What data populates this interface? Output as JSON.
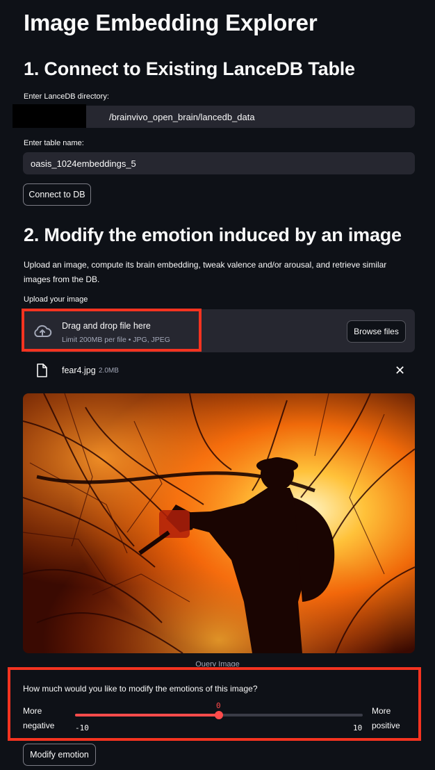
{
  "app_title": "Image Embedding Explorer",
  "section1": {
    "heading": "1. Connect to Existing LanceDB Table",
    "dir_label": "Enter LanceDB directory:",
    "dir_value": "/brainvivo_open_brain/lancedb_data",
    "table_label": "Enter table name:",
    "table_value": "oasis_1024embeddings_5",
    "connect_button": "Connect to DB"
  },
  "section2": {
    "heading": "2. Modify the emotion induced by an image",
    "description": "Upload an image, compute its brain embedding, tweak valence and/or arousal, and retrieve similar images from the DB.",
    "upload_label": "Upload your image",
    "dropzone_title": "Drag and drop file here",
    "dropzone_limit": "Limit 200MB per file • JPG, JPEG",
    "browse_button": "Browse files",
    "file_name": "fear4.jpg",
    "file_size": "2.0MB",
    "close_icon": "close-icon",
    "image_caption": "Query Image",
    "question": "How much would you like to modify the emotions of this image?",
    "left_label_1": "More",
    "left_label_2": "negative",
    "right_label_1": "More",
    "right_label_2": "positive",
    "slider_value": "0",
    "slider_min": "-10",
    "slider_max": "10",
    "modify_button": "Modify emotion"
  },
  "colors": {
    "background": "#0e1117",
    "field": "#262730",
    "accent": "#ff4b4b",
    "highlight": "#f43320"
  }
}
